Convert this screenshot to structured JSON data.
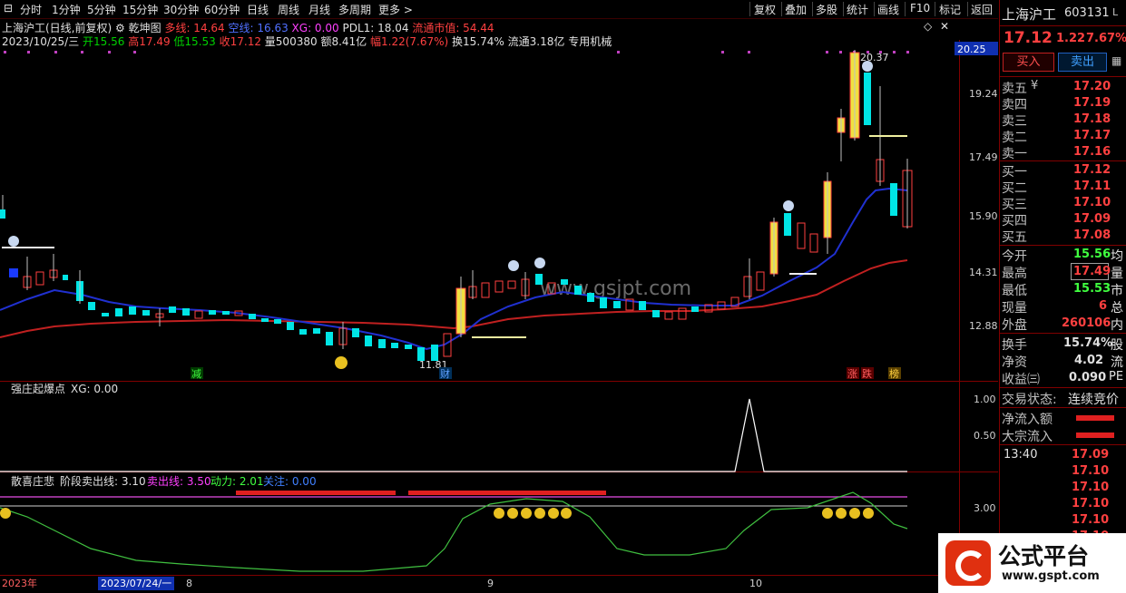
{
  "toolbar": {
    "periods": [
      "分时",
      "1分钟",
      "5分钟",
      "15分钟",
      "30分钟",
      "60分钟",
      "日线",
      "周线",
      "月线",
      "多周期",
      "更多 >"
    ],
    "right": [
      "复权",
      "叠加",
      "多股",
      "统计",
      "画线",
      "F10",
      "标记",
      "返回"
    ]
  },
  "info": {
    "title": "上海沪工(日线,前复权)",
    "indicator_name": "乾坤图",
    "duoxian": "多线: 14.64",
    "kongxian": "空线: 16.63",
    "xg": "XG: 0.00",
    "pdl": "PDL1: 18.04",
    "market_cap": "流通市值: 54.44",
    "date": "2023/10/25/三",
    "open": "开15.56",
    "high": "高17.49",
    "low": "低15.53",
    "close": "收17.12",
    "volume": "量500380",
    "amount": "额8.41亿",
    "change": "幅1.22(7.67%)",
    "turnover": "换15.74%",
    "float": "流通3.18亿",
    "industry": "专用机械"
  },
  "price_axis": [
    "20.25",
    "19.24",
    "17.49",
    "15.90",
    "14.31",
    "12.88"
  ],
  "annotations": {
    "peak_price": "20.37",
    "low_price": "11.81",
    "tag_jian": "减",
    "tag_cai": "财",
    "tag_zhang": "涨",
    "tag_die": "跌",
    "tag_bang": "榜",
    "watermark": "www.gsjpt.com"
  },
  "panel2": {
    "title": "强庄起爆点",
    "xg": "XG: 0.00",
    "axis": [
      "1.00",
      "0.50"
    ]
  },
  "panel3": {
    "title": "散喜庄悲",
    "stage": "阶段卖出线: 3.10",
    "sell": "卖出线: 3.50",
    "power": "动力: 2.01",
    "attention": "关注: 0.00",
    "axis": [
      "3.00"
    ]
  },
  "date_axis": {
    "year": "2023年",
    "cursor_date": "2023/07/24/一",
    "months": [
      "8",
      "9",
      "10"
    ]
  },
  "quote": {
    "name": "上海沪工",
    "code": "603131",
    "suffix": "L",
    "price": "17.12",
    "change": "1.22",
    "pct": "7.67%",
    "buy_btn": "买入",
    "sell_btn": "卖出",
    "asks": [
      {
        "label": "卖五",
        "price": "17.20"
      },
      {
        "label": "卖四",
        "price": "17.19"
      },
      {
        "label": "卖三",
        "price": "17.18"
      },
      {
        "label": "卖二",
        "price": "17.17"
      },
      {
        "label": "卖一",
        "price": "17.16"
      }
    ],
    "bids": [
      {
        "label": "买一",
        "price": "17.12"
      },
      {
        "label": "买二",
        "price": "17.11"
      },
      {
        "label": "买三",
        "price": "17.10"
      },
      {
        "label": "买四",
        "price": "17.09"
      },
      {
        "label": "买五",
        "price": "17.08"
      }
    ],
    "stats": [
      {
        "label": "今开",
        "value": "15.56",
        "extra": "均"
      },
      {
        "label": "最高",
        "value": "17.49",
        "extra": "量"
      },
      {
        "label": "最低",
        "value": "15.53",
        "extra": "市"
      },
      {
        "label": "现量",
        "value": "6",
        "extra": "总"
      },
      {
        "label": "外盘",
        "value": "260106",
        "extra": "内"
      }
    ],
    "stats2": [
      {
        "label": "换手",
        "value": "15.74%",
        "extra": "股"
      },
      {
        "label": "净资",
        "value": "4.02",
        "extra": "流"
      },
      {
        "label": "收益㈢",
        "value": "0.090",
        "extra": "PE"
      }
    ],
    "trade_state_label": "交易状态:",
    "trade_state": "连续竞价",
    "net_inflow": "净流入额",
    "block_inflow": "大宗流入",
    "ticks": [
      {
        "time": "13:40",
        "price": "17.09"
      },
      {
        "time": "",
        "price": "17.10"
      },
      {
        "time": "",
        "price": "17.10"
      },
      {
        "time": "",
        "price": "17.10"
      },
      {
        "time": "",
        "price": "17.10"
      },
      {
        "time": "",
        "price": "17.10"
      }
    ]
  },
  "logo": {
    "text": "公式平台",
    "url": "www.gspt.com"
  },
  "colors": {
    "up": "#ff4040",
    "down": "#00e5e5",
    "bull_fill": "#f0e040",
    "blue_line": "#2030d0",
    "red_line": "#d02020",
    "green_line": "#30c030"
  }
}
